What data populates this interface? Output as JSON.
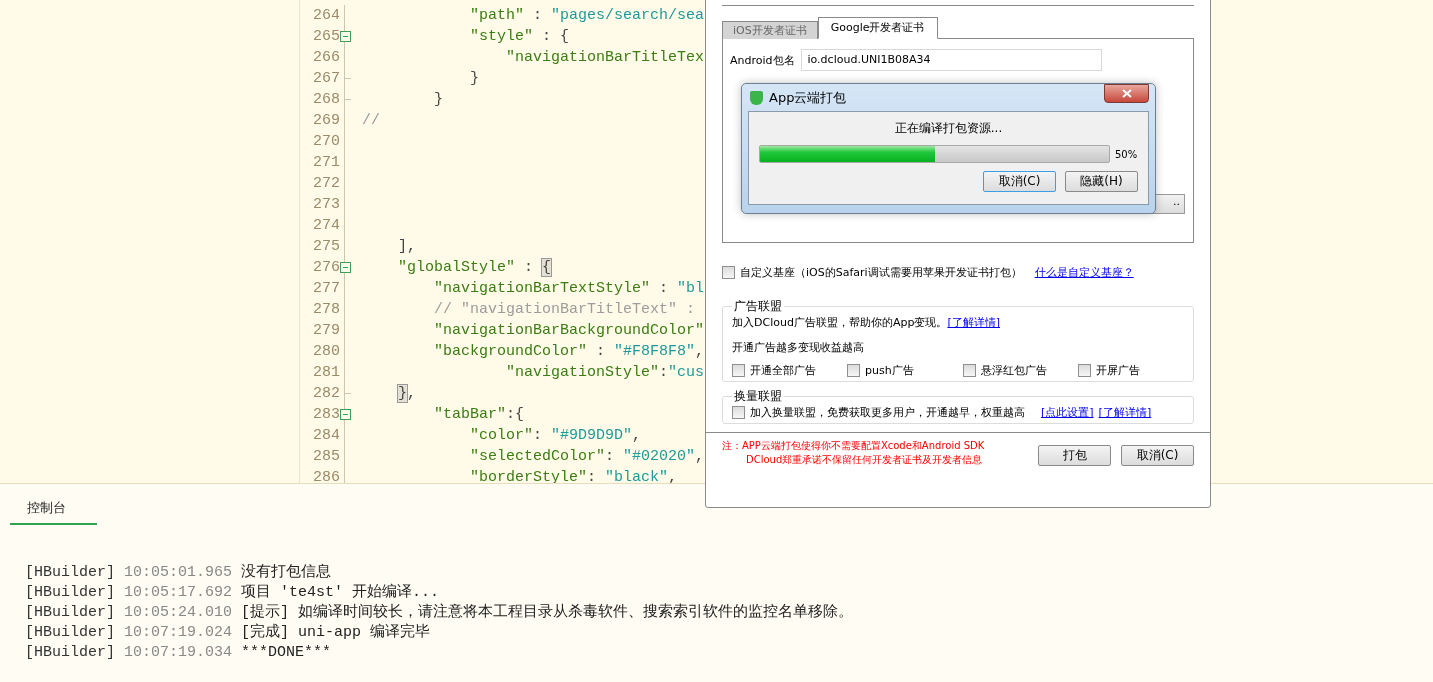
{
  "editor": {
    "lines": [
      {
        "number": "264",
        "collapsible": false,
        "block_end": false,
        "tokens": [
          {
            "kind": "key",
            "text": "            \"path\""
          },
          {
            "kind": "punct",
            "text": " : "
          },
          {
            "kind": "string",
            "text": "\"pages/search/sea"
          }
        ]
      },
      {
        "number": "265",
        "collapsible": true,
        "block_end": false,
        "tokens": [
          {
            "kind": "key",
            "text": "            \"style\""
          },
          {
            "kind": "punct",
            "text": " : {"
          }
        ]
      },
      {
        "number": "266",
        "collapsible": false,
        "block_end": false,
        "tokens": [
          {
            "kind": "key",
            "text": "                \"navigationBarTitleTex"
          }
        ]
      },
      {
        "number": "267",
        "collapsible": false,
        "block_end": true,
        "tokens": [
          {
            "kind": "punct",
            "text": "            }"
          }
        ]
      },
      {
        "number": "268",
        "collapsible": false,
        "block_end": true,
        "tokens": [
          {
            "kind": "punct",
            "text": "        }"
          }
        ]
      },
      {
        "number": "269",
        "collapsible": false,
        "block_end": false,
        "tokens": [
          {
            "kind": "comment",
            "text": "//"
          }
        ]
      },
      {
        "number": "270",
        "collapsible": false,
        "block_end": false
      },
      {
        "number": "271",
        "collapsible": false,
        "block_end": false
      },
      {
        "number": "272",
        "collapsible": false,
        "block_end": false
      },
      {
        "number": "273",
        "collapsible": false,
        "block_end": false
      },
      {
        "number": "274",
        "collapsible": false,
        "block_end": false
      },
      {
        "number": "275",
        "collapsible": false,
        "block_end": false,
        "tokens": [
          {
            "kind": "punct",
            "text": "    ],"
          }
        ]
      },
      {
        "number": "276",
        "collapsible": true,
        "block_end": false,
        "tokens": [
          {
            "kind": "key",
            "text": "    \"globalStyle\""
          },
          {
            "kind": "punct",
            "text": " : "
          },
          {
            "kind": "bracket",
            "text": "{"
          }
        ]
      },
      {
        "number": "277",
        "collapsible": false,
        "block_end": false,
        "tokens": [
          {
            "kind": "key",
            "text": "        \"navigationBarTextStyle\""
          },
          {
            "kind": "punct",
            "text": " : "
          },
          {
            "kind": "string",
            "text": "\"bl"
          }
        ]
      },
      {
        "number": "278",
        "collapsible": false,
        "block_end": false,
        "tokens": [
          {
            "kind": "comment",
            "text": "        // \"navigationBarTitleText\" :"
          }
        ]
      },
      {
        "number": "279",
        "collapsible": false,
        "block_end": false,
        "tokens": [
          {
            "kind": "key",
            "text": "        \"navigationBarBackgroundColor\""
          }
        ]
      },
      {
        "number": "280",
        "collapsible": false,
        "block_end": false,
        "tokens": [
          {
            "kind": "key",
            "text": "        \"backgroundColor\""
          },
          {
            "kind": "punct",
            "text": " : "
          },
          {
            "kind": "string",
            "text": "\"#F8F8F8\""
          },
          {
            "kind": "punct",
            "text": ","
          }
        ]
      },
      {
        "number": "281",
        "collapsible": false,
        "block_end": false,
        "tokens": [
          {
            "kind": "key",
            "text": "                \"navigationStyle\""
          },
          {
            "kind": "punct",
            "text": ":"
          },
          {
            "kind": "string",
            "text": "\"cus"
          }
        ]
      },
      {
        "number": "282",
        "collapsible": false,
        "block_end": true,
        "tokens": [
          {
            "kind": "bracket",
            "text": "    }"
          },
          {
            "kind": "punct",
            "text": ","
          }
        ]
      },
      {
        "number": "283",
        "collapsible": true,
        "block_end": false,
        "tokens": [
          {
            "kind": "key",
            "text": "        \"tabBar\""
          },
          {
            "kind": "punct",
            "text": ":{"
          }
        ]
      },
      {
        "number": "284",
        "collapsible": false,
        "block_end": false,
        "tokens": [
          {
            "kind": "key",
            "text": "            \"color\""
          },
          {
            "kind": "punct",
            "text": ": "
          },
          {
            "kind": "string",
            "text": "\"#9D9D9D\""
          },
          {
            "kind": "punct",
            "text": ","
          }
        ]
      },
      {
        "number": "285",
        "collapsible": false,
        "block_end": false,
        "tokens": [
          {
            "kind": "key",
            "text": "            \"selectedColor\""
          },
          {
            "kind": "punct",
            "text": ": "
          },
          {
            "kind": "string",
            "text": "\"#02020\""
          },
          {
            "kind": "punct",
            "text": ","
          }
        ]
      },
      {
        "number": "286",
        "collapsible": false,
        "block_end": false,
        "tokens": [
          {
            "kind": "key",
            "text": "            \"borderStyle\""
          },
          {
            "kind": "punct",
            "text": ": "
          },
          {
            "kind": "string",
            "text": "\"black\""
          },
          {
            "kind": "punct",
            "text": ","
          }
        ]
      }
    ]
  },
  "console": {
    "tab": "控制台",
    "lines": [
      {
        "source": "[HBuilder]",
        "time": "10:05:01.965",
        "message": "没有打包信息"
      },
      {
        "source": "[HBuilder]",
        "time": "10:05:17.692",
        "message": "项目 'te4st' 开始编译..."
      },
      {
        "source": "[HBuilder]",
        "time": "10:05:24.010",
        "message": "[提示] 如编译时间较长，请注意将本工程目录从杀毒软件、搜索索引软件的监控名单移除。"
      },
      {
        "source": "[HBuilder]",
        "time": "10:07:19.024",
        "message": "[完成] uni-app 编译完毕"
      },
      {
        "source": "[HBuilder]",
        "time": "10:07:19.034",
        "message": "***DONE***"
      }
    ]
  },
  "pack_dialog": {
    "tabs": [
      {
        "label": "iOS开发者证书",
        "selected": false
      },
      {
        "label": "Google开发者证书",
        "selected": true
      }
    ],
    "package_label": "Android包名",
    "package_value": "io.dcloud.UNI1B08A34",
    "browse_button": "..",
    "custom_base": {
      "label": "自定义基座（iOS的Safari调试需要用苹果开发证书打包）",
      "checked": false,
      "link": "什么是自定义基座？"
    },
    "ad_group": {
      "title": "广告联盟",
      "intro": "加入DCloud广告联盟，帮助你的App变现。",
      "intro_link": "[了解详情]",
      "hint": "开通广告越多变现收益越高",
      "options": [
        {
          "label": "开通全部广告",
          "checked": false
        },
        {
          "label": "push广告",
          "checked": false
        },
        {
          "label": "悬浮红包广告",
          "checked": false
        },
        {
          "label": "开屏广告",
          "checked": false
        }
      ]
    },
    "exchange_group": {
      "title": "换量联盟",
      "label": "加入换量联盟，免费获取更多用户，开通越早，权重越高",
      "checked": false,
      "links": [
        "[点此设置]",
        "[了解详情]"
      ]
    },
    "notes": [
      "注：APP云端打包使得你不需要配置Xcode和Android SDK",
      "DCloud郑重承诺不保留任何开发者证书及开发者信息"
    ],
    "buttons": [
      "打包",
      "取消(C)"
    ]
  },
  "progress_dialog": {
    "title": "App云端打包",
    "message": "正在编译打包资源...",
    "level": 0.5,
    "percent": "50%",
    "buttons": [
      {
        "label": "取消(C)",
        "focused": true
      },
      {
        "label": "隐藏(H)",
        "focused": false
      }
    ]
  }
}
